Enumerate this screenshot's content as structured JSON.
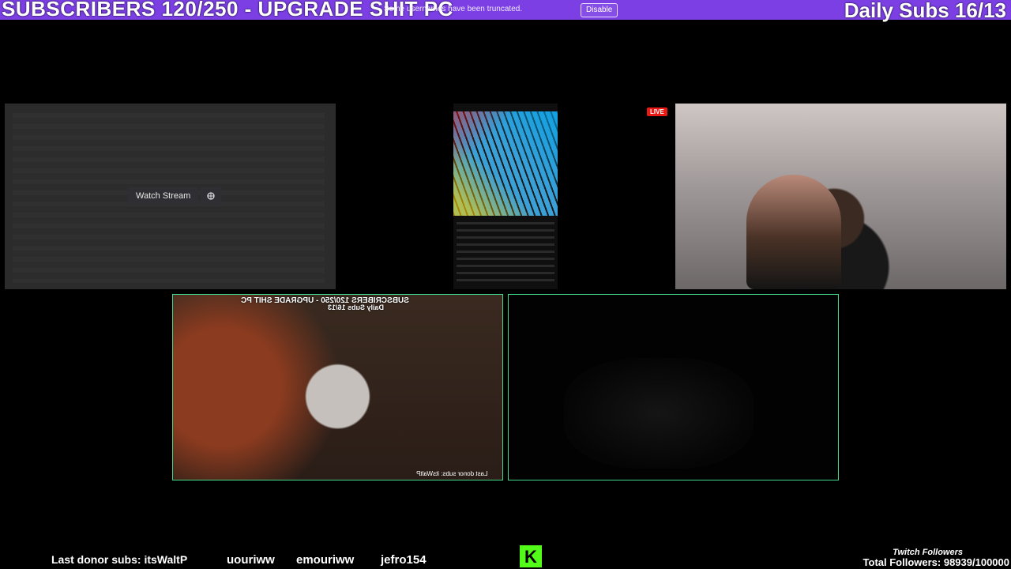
{
  "header": {
    "title": "SUBSCRIBERS 120/250 - UPGRADE SHIT PC",
    "daily_subs": "Daily Subs 16/13"
  },
  "notice": {
    "text": "Some usernames have been truncated.",
    "disable_label": "Disable"
  },
  "screen_share": {
    "watch_label": "Watch Stream",
    "popout_icon": "popout-icon"
  },
  "live_badge": "LIVE",
  "mirrored_overlay": {
    "title": "SUBSCRIBERS 120/250 - UPGRADE SHIT PC",
    "daily": "Daily Subs 16/13",
    "donor": "Last donor subs: itsWaltP"
  },
  "bottom": {
    "donor": "Last donor subs: itsWaltP",
    "ticker": [
      "uouriww",
      "emouriww",
      "jefro154"
    ],
    "followers_label": "Twitch Followers",
    "followers_total": "Total Followers: 98939/100000"
  },
  "colors": {
    "header": "#7b3fe4",
    "tile_border": "#41d88a",
    "live": "#e91916",
    "kick": "#53fc18"
  }
}
